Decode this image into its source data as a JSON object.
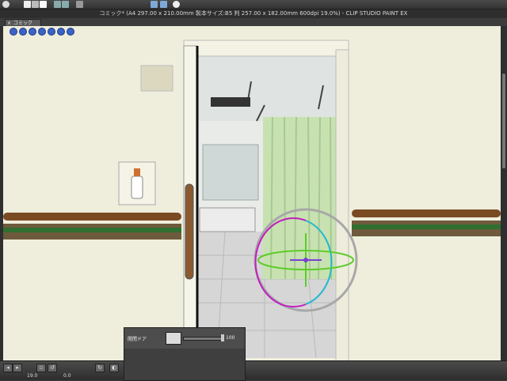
{
  "window": {
    "title": "コミック* (A4 297.00 x 210.00mm 製本サイズ:B5 判 257.00 x 182.00mm 600dpi 19.0%)  - CLIP STUDIO PAINT EX"
  },
  "doc_tab": {
    "close": "×",
    "label": "コミック"
  },
  "toolbar": {
    "icons": [
      "eye-icon",
      "new-icon",
      "open-icon",
      "save-icon",
      "undo-icon",
      "redo-icon",
      "transform-icon",
      "grid-icon",
      "ruler-icon",
      "help-icon"
    ]
  },
  "palette": {
    "label": "開閉ドア",
    "value": "100",
    "level": 1.0
  },
  "status": {
    "zoom": "19.0",
    "angle": "0.0"
  },
  "colors": {
    "gizmo_magenta": "#c020c0",
    "gizmo_green": "#5ecb2a",
    "gizmo_cyan": "#20b8d0",
    "rail_green": "#2f6f2f",
    "rail_brown": "#7a4a22",
    "curtain": "#c7e2b0"
  }
}
